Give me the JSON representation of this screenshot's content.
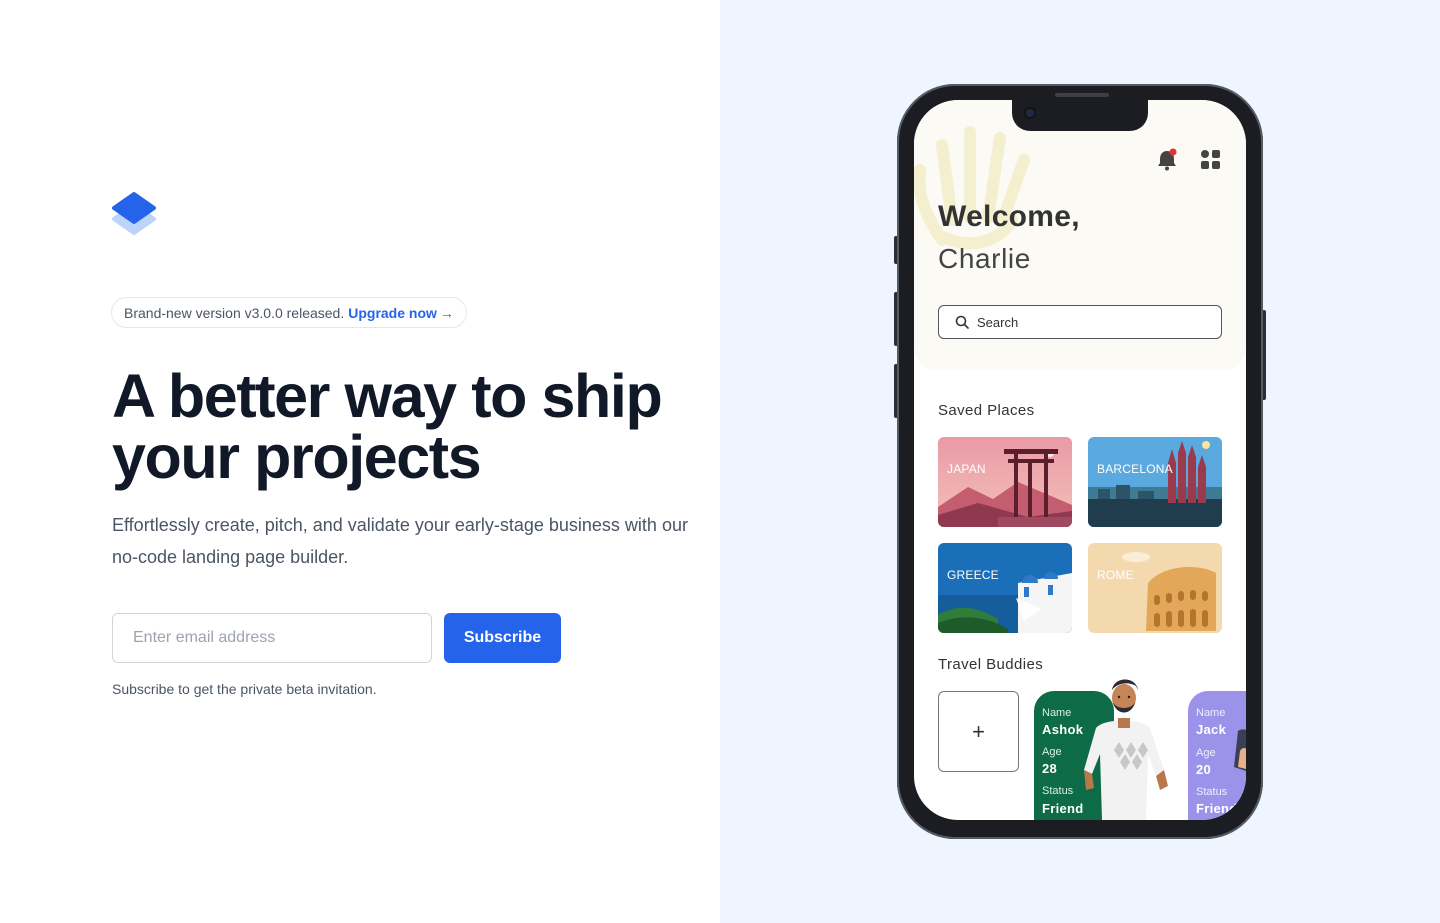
{
  "colors": {
    "primary": "#2563eb",
    "title": "#111827",
    "panel": "#eef5ff"
  },
  "brand": {
    "logo_icon": "stacked-layers-logo"
  },
  "banner": {
    "text": "Brand-new version v3.0.0 released.",
    "link": "Upgrade now",
    "arrow": "→"
  },
  "hero": {
    "title_line1": "A better way to ship",
    "title_line2": "your projects",
    "subtitle": "Effortlessly create, pitch, and validate your early-stage business with our no-code landing page builder."
  },
  "form": {
    "email_placeholder": "Enter email address",
    "button": "Subscribe",
    "hint": "Subscribe to get the private beta invitation."
  },
  "app": {
    "welcome": "Welcome,",
    "user": "Charlie",
    "search_placeholder": "Search",
    "saved_places_title": "Saved Places",
    "places": [
      {
        "name": "JAPAN"
      },
      {
        "name": "BARCELONA"
      },
      {
        "name": "GREECE"
      },
      {
        "name": "ROME"
      }
    ],
    "buddies_title": "Travel Buddies",
    "add_symbol": "+",
    "buddies": [
      {
        "name_label": "Name",
        "name": "Ashok",
        "age_label": "Age",
        "age": "28",
        "status_label": "Status",
        "status": "Friend"
      },
      {
        "name_label": "Name",
        "name": "Jack",
        "age_label": "Age",
        "age": "20",
        "status_label": "Status",
        "status": "Friend"
      }
    ]
  }
}
